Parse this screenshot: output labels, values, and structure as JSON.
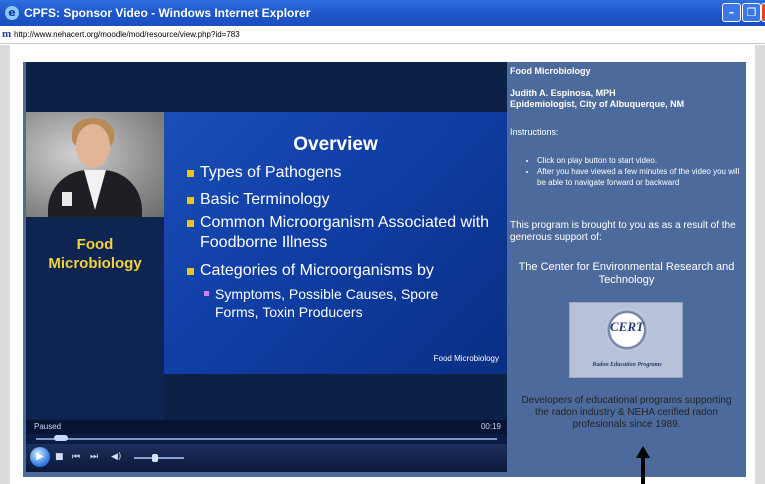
{
  "window": {
    "title": "CPFS: Sponsor Video - Windows Internet Explorer",
    "min_glyph": "–",
    "max_glyph": "❐",
    "icon": "ie-icon"
  },
  "address": {
    "icon": "moodle-icon",
    "icon_glyph": "m",
    "url": "http://www.nehacert.org/moodle/mod/resource/view.php?id=783"
  },
  "video": {
    "side_title": "Food\nMicrobiology",
    "slide": {
      "title": "Overview",
      "bullets": [
        "Types of Pathogens",
        "Basic Terminology",
        "Common Microorganism Associated with Foodborne Illness",
        "Categories of Microorganisms by"
      ],
      "sub_bullet": "Symptoms, Possible Causes, Spore Forms, Toxin Producers",
      "footer": "Food Microbiology"
    },
    "status": "Paused",
    "time": "00:19",
    "seek_position": 0.04,
    "volume_level": 0.35,
    "controls": {
      "play_glyph": "▶",
      "stop_glyph": "■",
      "prev_glyph": "⏮",
      "next_glyph": "⏭",
      "mute_glyph": "◀)"
    }
  },
  "info": {
    "title": "Food Microbiology",
    "author": "Judith A. Espinosa, MPH",
    "role": "Epidemiologist, City of Albuquerque, NM",
    "instructions_label": "Instructions:",
    "instructions": [
      "Click on play button to start video.",
      "After you have viewed a few minutes of the video you will be able to navigate forward or backward"
    ],
    "program_text": "This program is brought to you as as a result of the generous support of:",
    "center_name": "The Center for Environmental Research and Technology",
    "logo": {
      "text": "CERT",
      "sub": "Radon Education Programs"
    },
    "developers_text": "Developers of educational programs supporting the radon industry & NEHA cerified radon profesionals since 1989."
  },
  "colors": {
    "titlebar": "#1d55c8",
    "frame": "#4d6a9c",
    "slide_bg": "#0f3ea5",
    "accent_yellow": "#f2c21a",
    "side_title": "#f3d23a"
  }
}
